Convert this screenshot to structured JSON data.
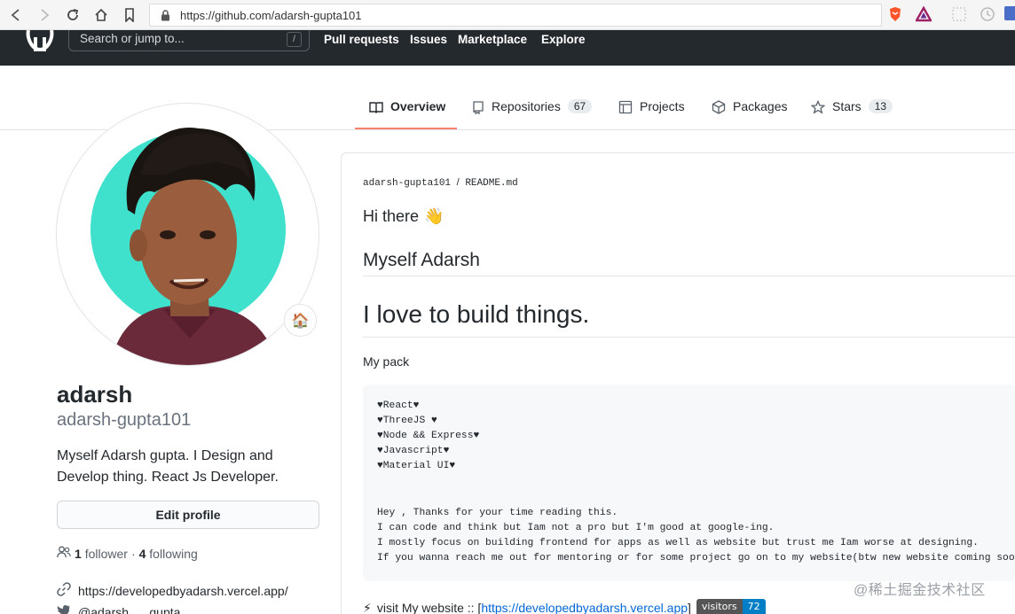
{
  "browser": {
    "url": "https://github.com/adarsh-gupta101"
  },
  "header": {
    "search_placeholder": "Search or jump to...",
    "search_shortcut": "/",
    "nav": [
      "Pull requests",
      "Issues",
      "Marketplace",
      "Explore"
    ]
  },
  "tabs": [
    {
      "label": "Overview",
      "count": null,
      "active": true
    },
    {
      "label": "Repositories",
      "count": "67",
      "active": false
    },
    {
      "label": "Projects",
      "count": null,
      "active": false
    },
    {
      "label": "Packages",
      "count": null,
      "active": false
    },
    {
      "label": "Stars",
      "count": "13",
      "active": false
    }
  ],
  "profile": {
    "name": "adarsh",
    "login": "adarsh-gupta101",
    "bio": "Myself Adarsh gupta. I Design and Develop thing. React Js Developer.",
    "status_emoji": "🏠",
    "edit_label": "Edit profile",
    "followers_count": "1",
    "followers_label": "follower",
    "separator": "·",
    "following_count": "4",
    "following_label": "following",
    "website": "https://developedbyadarsh.vercel.app/",
    "twitter": "@adarsh___gupta"
  },
  "readme": {
    "path_user": "adarsh-gupta101",
    "path_sep": "/",
    "path_file": "README.md",
    "greeting": "Hi there",
    "greeting_emoji": "👋",
    "h2": "Myself Adarsh",
    "h1": "I love to build things.",
    "pack_label": "My pack",
    "code_lines": [
      "♥React♥",
      "♥ThreeJS ♥",
      "♥Node && Express♥",
      "♥Javascript♥",
      "♥Material UI♥",
      "",
      "",
      "Hey , Thanks for your time reading this.",
      "I can code and think but Iam not a pro but I'm good at google-ing.",
      "I mostly focus on building frontend for apps as well as website but trust me Iam worse at designing.",
      "If you wanna reach me out for mentoring or for some project go on to my website(btw new website coming soon)"
    ],
    "visit_emoji": "⚡",
    "visit_text": "visit My website :: [",
    "visit_link": "https://developedbyadarsh.vercel.app",
    "visit_close": "]",
    "badge_label": "visitors",
    "badge_value": "72"
  },
  "watermark": "@稀土掘金技术社区",
  "colors": {
    "header_bg": "#24292e",
    "tab_active": "#f9826c",
    "link": "#0366d6",
    "avatar_bg": "#3fe0cc"
  }
}
